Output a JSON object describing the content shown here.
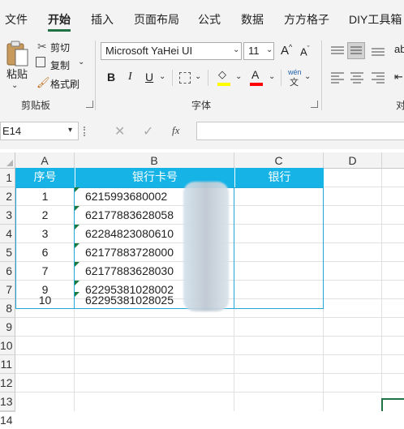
{
  "menu": {
    "tabs": [
      {
        "label": "文件"
      },
      {
        "label": "开始"
      },
      {
        "label": "插入"
      },
      {
        "label": "页面布局"
      },
      {
        "label": "公式"
      },
      {
        "label": "数据"
      },
      {
        "label": "方方格子"
      },
      {
        "label": "DIY工具箱"
      }
    ],
    "active": "开始"
  },
  "ribbon": {
    "clipboard": {
      "paste_label": "粘贴",
      "cut_label": "剪切",
      "copy_label": "复制",
      "format_painter_label": "格式刷",
      "group_label": "剪贴板"
    },
    "font": {
      "font_name": "Microsoft YaHei UI",
      "font_size": "11",
      "bold": "B",
      "italic": "I",
      "underline": "U",
      "phonetic": "wén",
      "group_label": "字体",
      "fill_color": "#ffff00",
      "font_color": "#ff0000"
    },
    "alignment": {
      "group_label_partial": "对"
    }
  },
  "formula_bar": {
    "name_box": "E14",
    "fx": "fx",
    "value": ""
  },
  "sheet": {
    "columns": [
      "A",
      "B",
      "C",
      "D"
    ],
    "rows": [
      "1",
      "2",
      "3",
      "4",
      "5",
      "6",
      "7",
      "8",
      "9",
      "10",
      "11",
      "12",
      "13",
      "14"
    ],
    "header": [
      "序号",
      "银行卡号",
      "银行"
    ],
    "data": [
      {
        "seq": "1",
        "card": "6215993680002"
      },
      {
        "seq": "2",
        "card": "62177883628058"
      },
      {
        "seq": "3",
        "card": "62284823080610"
      },
      {
        "seq": "6",
        "card": "62177883728000"
      },
      {
        "seq": "7",
        "card": "62177883628030"
      },
      {
        "seq": "9",
        "card": "62295381028002"
      },
      {
        "seq": "10",
        "card": "62295381028025"
      }
    ],
    "header_color": "#15b3e6",
    "border_color": "#1fa8d6"
  }
}
